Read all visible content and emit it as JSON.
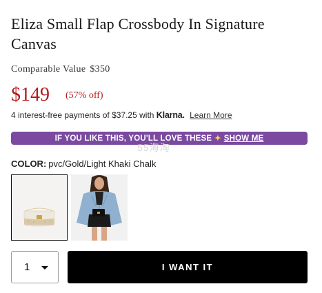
{
  "product": {
    "title": "Eliza Small Flap Crossbody In Signature Canvas",
    "comparable_label": "Comparable Value",
    "comparable_value": "$350",
    "price": "$149",
    "discount": "(57% off)"
  },
  "klarna": {
    "text": "4 interest-free payments of $37.25 with",
    "logo": "Klarna.",
    "learn_more": "Learn More"
  },
  "promo": {
    "text": "IF YOU LIKE THIS, YOU'LL LOVE THESE",
    "link": "SHOW ME"
  },
  "watermark": "55海淘",
  "color": {
    "label": "COLOR:",
    "value": "pvc/Gold/Light Khaki Chalk"
  },
  "swatches": [
    {
      "name": "product-bag-image",
      "selected": true
    },
    {
      "name": "model-wearing-bag-image",
      "selected": false
    }
  ],
  "quantity": {
    "value": "1"
  },
  "cta": {
    "label": "I WANT IT"
  },
  "colors": {
    "price_red": "#b31b1b",
    "promo_purple": "#7b4aa0",
    "button_black": "#000000"
  }
}
